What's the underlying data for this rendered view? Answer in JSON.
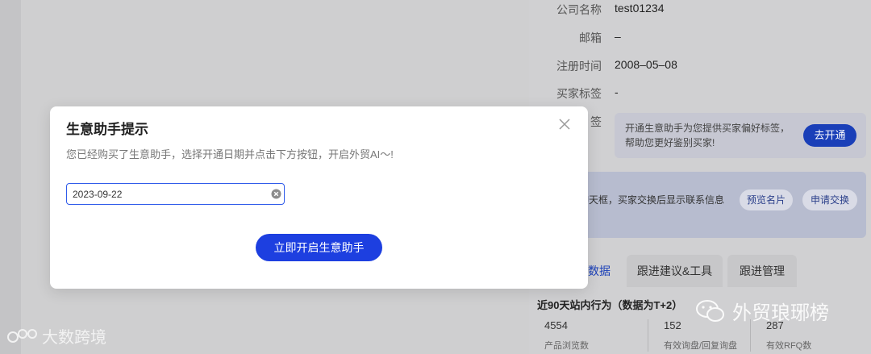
{
  "buyer_info": {
    "company_label": "公司名称",
    "company_value": "test01234",
    "email_label": "邮箱",
    "email_value": "–",
    "registered_label": "注册时间",
    "registered_value": "2008–05–08",
    "buyer_tags_label": "买家标签",
    "buyer_tags_value": "-",
    "tags_label_partial": "签"
  },
  "promo": {
    "text": "开通生意助手为您提供买家偏好标签，帮助您更好鉴别买家!",
    "button": "去开通"
  },
  "contact": {
    "text": "聊天框，买家交换后显示联系信息",
    "preview_button": "预览名片",
    "exchange_button": "申请交换"
  },
  "tabs": [
    {
      "label": "数据"
    },
    {
      "label": "跟进建议&工具"
    },
    {
      "label": "跟进管理"
    }
  ],
  "stats": {
    "title": "近90天站内行为（数据为T+2）",
    "items": [
      {
        "value": "4554",
        "label": "产品浏览数"
      },
      {
        "value": "152",
        "label": "有效询盘/回复询盘"
      },
      {
        "value": "287",
        "label": "有效RFQ数"
      }
    ]
  },
  "watermarks": {
    "left": "大数跨境",
    "right": "外贸琅琊榜"
  },
  "modal": {
    "title": "生意助手提示",
    "description": "您已经购买了生意助手，选择开通日期并点击下方按钮，开启外贸AI～!",
    "date_value": "2023-09-22",
    "submit_button": "立即开启生意助手"
  },
  "colors": {
    "primary": "#1d3fe0",
    "input_border": "#2f5bea",
    "overlay": "#cfcfd0"
  }
}
